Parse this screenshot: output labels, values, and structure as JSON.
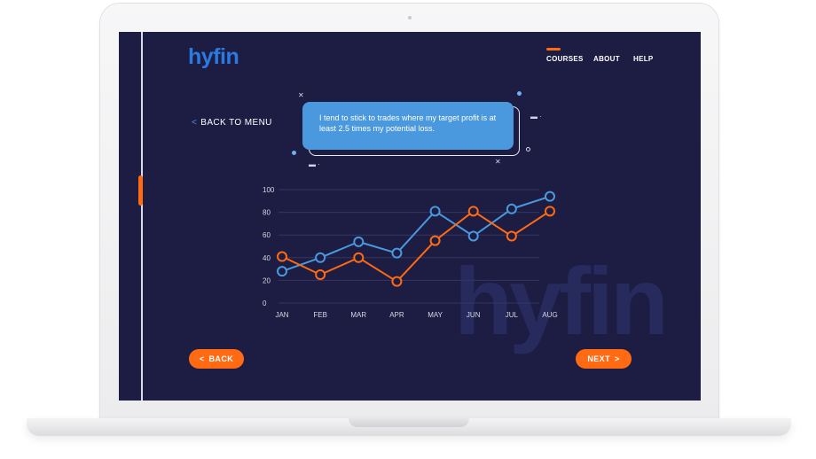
{
  "app": {
    "logo": "hyfin",
    "watermark": "hyfin"
  },
  "nav": {
    "items": [
      {
        "label": "COURSES",
        "active": true
      },
      {
        "label": "ABOUT",
        "active": false
      },
      {
        "label": "HELP",
        "active": false
      }
    ]
  },
  "back_to_menu": {
    "icon": "chevron-left-icon",
    "label": "BACK TO MENU"
  },
  "bubble": {
    "text": "I tend to stick to trades where my target profit is at least 2.5 times my potential loss."
  },
  "buttons": {
    "back": {
      "label": "BACK",
      "icon": "chevron-left-icon"
    },
    "next": {
      "label": "NEXT",
      "icon": "chevron-right-icon"
    }
  },
  "colors": {
    "background": "#1d1c42",
    "accent": "#ff6a13",
    "blue": "#4a98dd",
    "logo": "#2c79e0"
  },
  "chart_data": {
    "type": "line",
    "categories": [
      "JAN",
      "FEB",
      "MAR",
      "APR",
      "MAY",
      "JUN",
      "JUL",
      "AUG"
    ],
    "yticks": [
      "0",
      "20",
      "40",
      "60",
      "80",
      "100"
    ],
    "ylim": [
      0,
      100
    ],
    "grid": true,
    "series": [
      {
        "color": "#4a98dd",
        "values": [
          28,
          40,
          54,
          44,
          81,
          59,
          83,
          94
        ]
      },
      {
        "color": "#ff6a13",
        "values": [
          41,
          25,
          40,
          19,
          55,
          81,
          59,
          81
        ]
      }
    ]
  }
}
